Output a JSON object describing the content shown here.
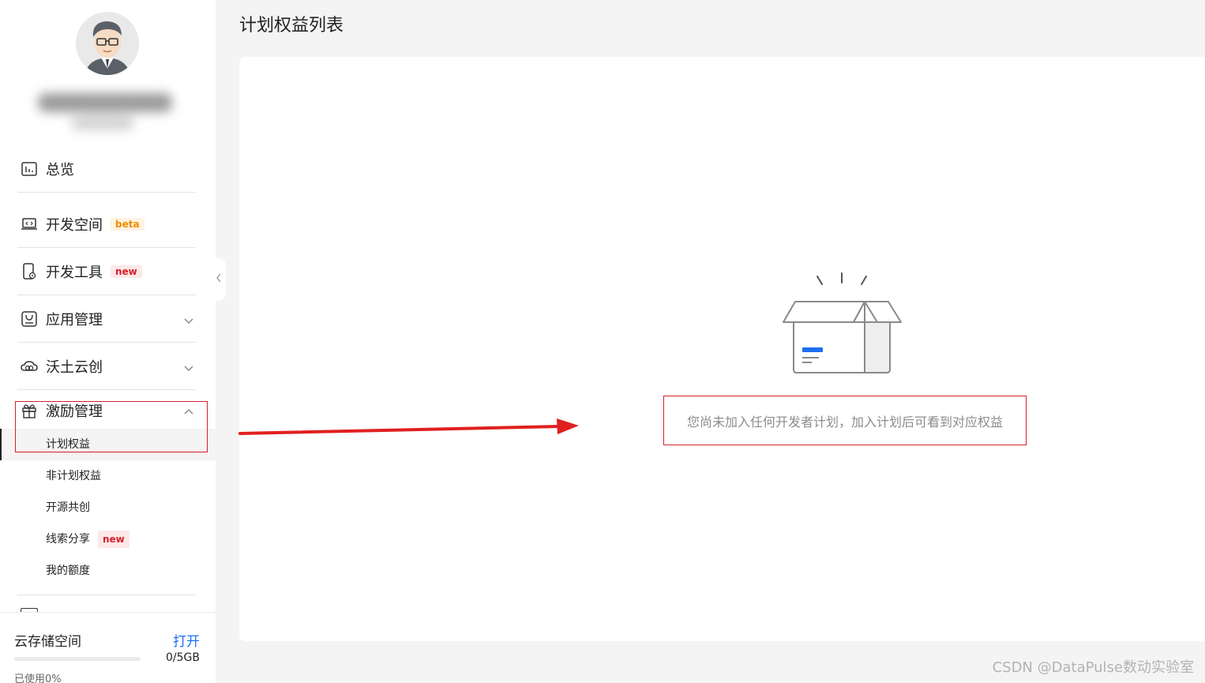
{
  "sidebar": {
    "nav": [
      {
        "label": "总览",
        "icon": "chart-icon"
      },
      {
        "label": "开发空间",
        "icon": "laptop-icon",
        "badge": "beta"
      },
      {
        "label": "开发工具",
        "icon": "device-icon",
        "badge": "new"
      },
      {
        "label": "应用管理",
        "icon": "app-icon"
      },
      {
        "label": "沃土云创",
        "icon": "cloud-icon"
      },
      {
        "label": "激励管理",
        "icon": "gift-icon"
      }
    ],
    "sub_items": [
      {
        "label": "计划权益"
      },
      {
        "label": "非计划权益"
      },
      {
        "label": "开源共创"
      },
      {
        "label": "线索分享",
        "badge": "new"
      },
      {
        "label": "我的额度"
      }
    ],
    "storage": {
      "title": "云存储空间",
      "open_label": "打开",
      "used": "0/5GB",
      "percent_label": "已使用0%",
      "percent": 0
    }
  },
  "main": {
    "title": "计划权益列表",
    "empty_message": "您尚未加入任何开发者计划，加入计划后可看到对应权益"
  },
  "watermark": "CSDN @DataPulse数动实验室",
  "colors": {
    "accent": "#1d6ff2",
    "annotation_red": "#d4202c"
  }
}
